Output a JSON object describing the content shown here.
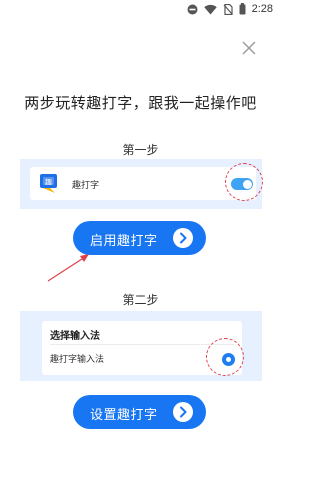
{
  "status_bar": {
    "time": "2:28",
    "icons": [
      "do-not-disturb-icon",
      "wifi-icon",
      "no-sim-icon",
      "battery-icon"
    ]
  },
  "close_icon": "close-icon",
  "headline": "两步玩转趣打字，跟我一起操作吧",
  "step1": {
    "label": "第一步",
    "app_name": "趣打字",
    "toggle_on": true,
    "button_label": "启用趣打字"
  },
  "step2": {
    "label": "第二步",
    "card_title": "选择输入法",
    "option_label": "趣打字输入法",
    "option_selected": true,
    "button_label": "设置趣打字"
  },
  "colors": {
    "accent": "#1976f2",
    "panel_bg": "#e7f0fe",
    "toggle": "#3ea3f2",
    "highlight": "#e0404a"
  }
}
